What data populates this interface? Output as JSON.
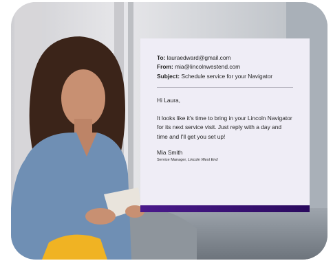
{
  "email": {
    "to_label": "To:",
    "to_value": "lauraedward@gmail.com",
    "from_label": "From:",
    "from_value": "mia@lincolnwestend.com",
    "subject_label": "Subject:",
    "subject_value": "Schedule service for your Navigator",
    "greeting": "Hi Laura,",
    "body": "It looks like it's time to bring in your Lincoln Navigator for its next service visit. Just reply with a day and time and I'll get you set up!",
    "signature_name": "Mia Smith",
    "signature_role": "Service Manager,",
    "signature_company": "Lincoln West End"
  },
  "colors": {
    "card_bg": "#efedf6",
    "accent": "#3b1278",
    "text": "#1f1f1f"
  }
}
